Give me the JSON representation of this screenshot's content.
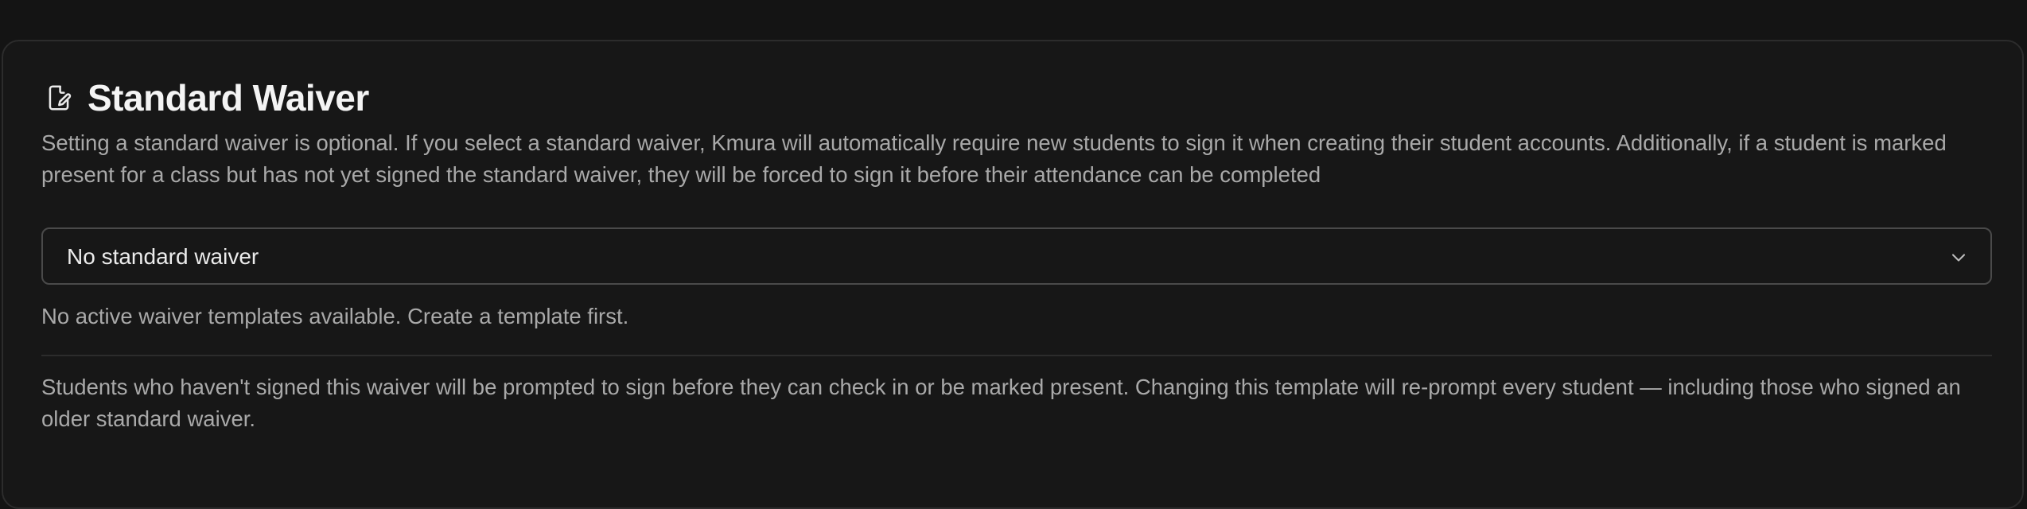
{
  "waiver_section": {
    "title": "Standard Waiver",
    "title_icon": "edit-document-icon",
    "description": "Setting a standard waiver is optional. If you select a standard waiver, Kmura will automatically require new students to sign it when creating their student accounts. Additionally, if a student is marked present for a class but has not yet signed the standard waiver, they will be forced to sign it before their attendance can be completed",
    "select": {
      "value": "No standard waiver",
      "icon": "chevron-down-icon"
    },
    "helper_text": "No active waiver templates available. Create a template first.",
    "footer_note": "Students who haven't signed this waiver will be prompted to sign before they can check in or be marked present. Changing this template will re-prompt every student — including those who signed an older standard waiver."
  },
  "colors": {
    "background": "#141414",
    "card": "#171717",
    "border": "#2c2c2c",
    "title": "#f4f4f4",
    "muted_text": "#a9a9a9"
  }
}
